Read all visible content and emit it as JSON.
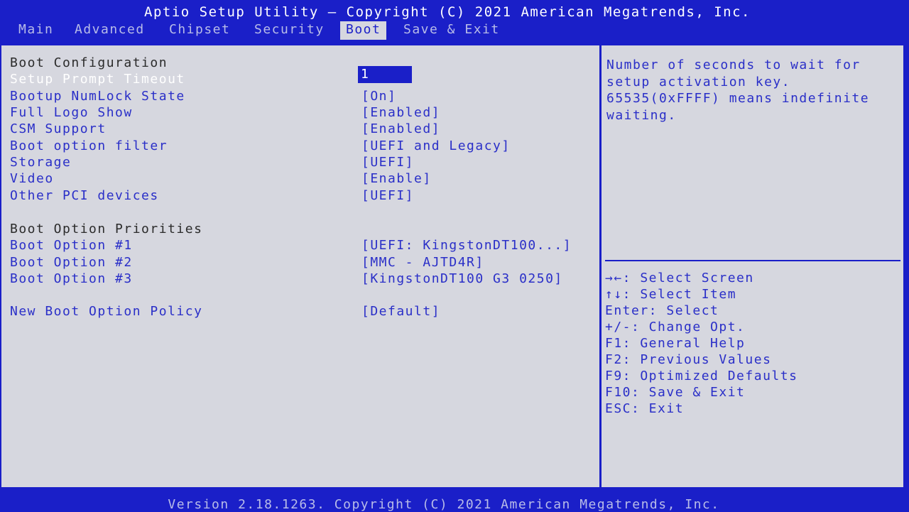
{
  "header": {
    "title": "Aptio Setup Utility – Copyright (C) 2021 American Megatrends, Inc.",
    "tabs": [
      {
        "label": "Main"
      },
      {
        "label": "Advanced"
      },
      {
        "label": "Chipset"
      },
      {
        "label": "Security"
      },
      {
        "label": "Boot"
      },
      {
        "label": "Save & Exit"
      }
    ],
    "active_tab": "Boot"
  },
  "settings": {
    "boot_config_heading": "Boot Configuration",
    "setup_prompt_timeout": {
      "label": "Setup Prompt Timeout",
      "value": "1"
    },
    "bootup_numlock_state": {
      "label": "Bootup NumLock State",
      "value": "[On]"
    },
    "full_logo_show": {
      "label": "Full Logo Show",
      "value": "[Enabled]"
    },
    "csm_support": {
      "label": "CSM Support",
      "value": "[Enabled]"
    },
    "boot_option_filter": {
      "label": "Boot option filter",
      "value": "[UEFI and Legacy]"
    },
    "storage": {
      "label": "Storage",
      "value": "[UEFI]"
    },
    "video": {
      "label": "Video",
      "value": "[Enable]"
    },
    "other_pci_devices": {
      "label": "Other PCI devices",
      "value": "[UEFI]"
    },
    "priorities_heading": "Boot Option Priorities",
    "boot_option_1": {
      "label": "Boot Option #1",
      "value": "[UEFI: KingstonDT100...]"
    },
    "boot_option_2": {
      "label": "Boot Option #2",
      "value": "[MMC - AJTD4R]"
    },
    "boot_option_3": {
      "label": "Boot Option #3",
      "value": "[KingstonDT100 G3 0250]"
    },
    "new_boot_option_policy": {
      "label": "New Boot Option Policy",
      "value": "[Default]"
    }
  },
  "help": {
    "text": "Number of seconds to wait for\nsetup activation key.\n65535(0xFFFF) means indefinite\nwaiting.",
    "keys": [
      "→←: Select Screen",
      "↑↓: Select Item",
      "Enter: Select",
      "+/-: Change Opt.",
      "F1: General Help",
      "F2: Previous Values",
      "F9: Optimized Defaults",
      "F10: Save & Exit",
      "ESC: Exit"
    ]
  },
  "footer": {
    "version": "Version 2.18.1263. Copyright (C) 2021 American Megatrends, Inc."
  },
  "colors": {
    "frame_blue": "#1a1fc8",
    "panel_gray": "#d6d7df",
    "text_blue": "#2a2fc8",
    "highlight_white": "#ffffff"
  }
}
